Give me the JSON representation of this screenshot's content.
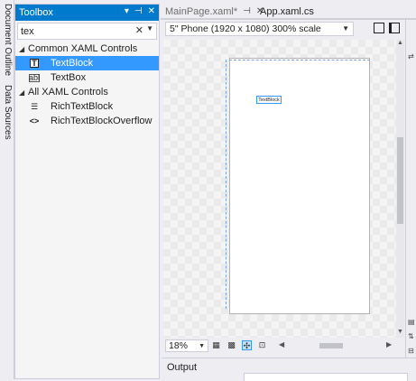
{
  "left_strip": {
    "document_outline": "Document Outline",
    "data_sources": "Data Sources"
  },
  "toolbox": {
    "title": "Toolbox",
    "search_value": "tex",
    "groups": [
      {
        "label": "Common XAML Controls",
        "items": [
          {
            "label": "TextBlock",
            "icon": "textblock-icon",
            "selected": true
          },
          {
            "label": "TextBox",
            "icon": "textbox-icon",
            "selected": false
          }
        ]
      },
      {
        "label": "All XAML Controls",
        "items": [
          {
            "label": "RichTextBlock",
            "icon": "richtextblock-icon",
            "selected": false
          },
          {
            "label": "RichTextBlockOverflow",
            "icon": "richtextblockoverflow-icon",
            "selected": false
          }
        ]
      }
    ]
  },
  "tabs": [
    {
      "label": "MainPage.xaml*",
      "active": false
    },
    {
      "label": "App.xaml.cs",
      "active": true
    }
  ],
  "designer": {
    "device_combo": "5\" Phone (1920 x 1080) 300% scale",
    "element_label": "TextBlock",
    "zoom_value": "18%"
  },
  "output_panel": {
    "label": "Output"
  },
  "colors": {
    "accent": "#007acc",
    "selection": "#3399ff"
  }
}
